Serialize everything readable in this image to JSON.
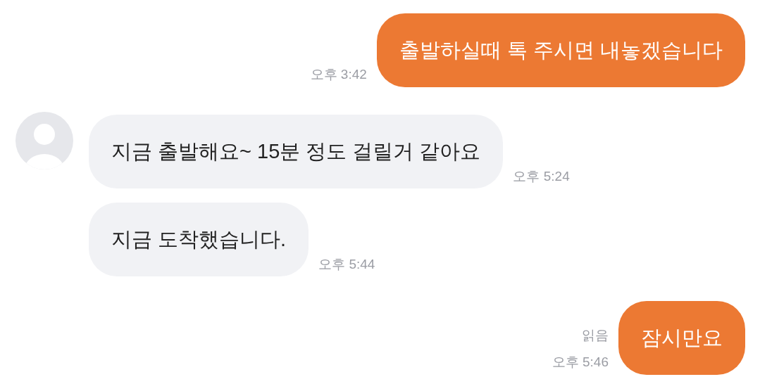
{
  "messages": [
    {
      "kind": "outgoing",
      "text": "출발하실때 톡 주시면 내놓겠습니다",
      "time": "오후 3:42"
    },
    {
      "kind": "incoming",
      "show_avatar": true,
      "text": "지금 출발해요~ 15분 정도 걸릴거 같아요",
      "time": "오후 5:24"
    },
    {
      "kind": "incoming",
      "show_avatar": false,
      "text": "지금 도착했습니다.",
      "time": "오후 5:44"
    },
    {
      "kind": "outgoing",
      "read_receipt": "읽음",
      "text": "잠시만요",
      "time": "오후 5:46"
    }
  ]
}
